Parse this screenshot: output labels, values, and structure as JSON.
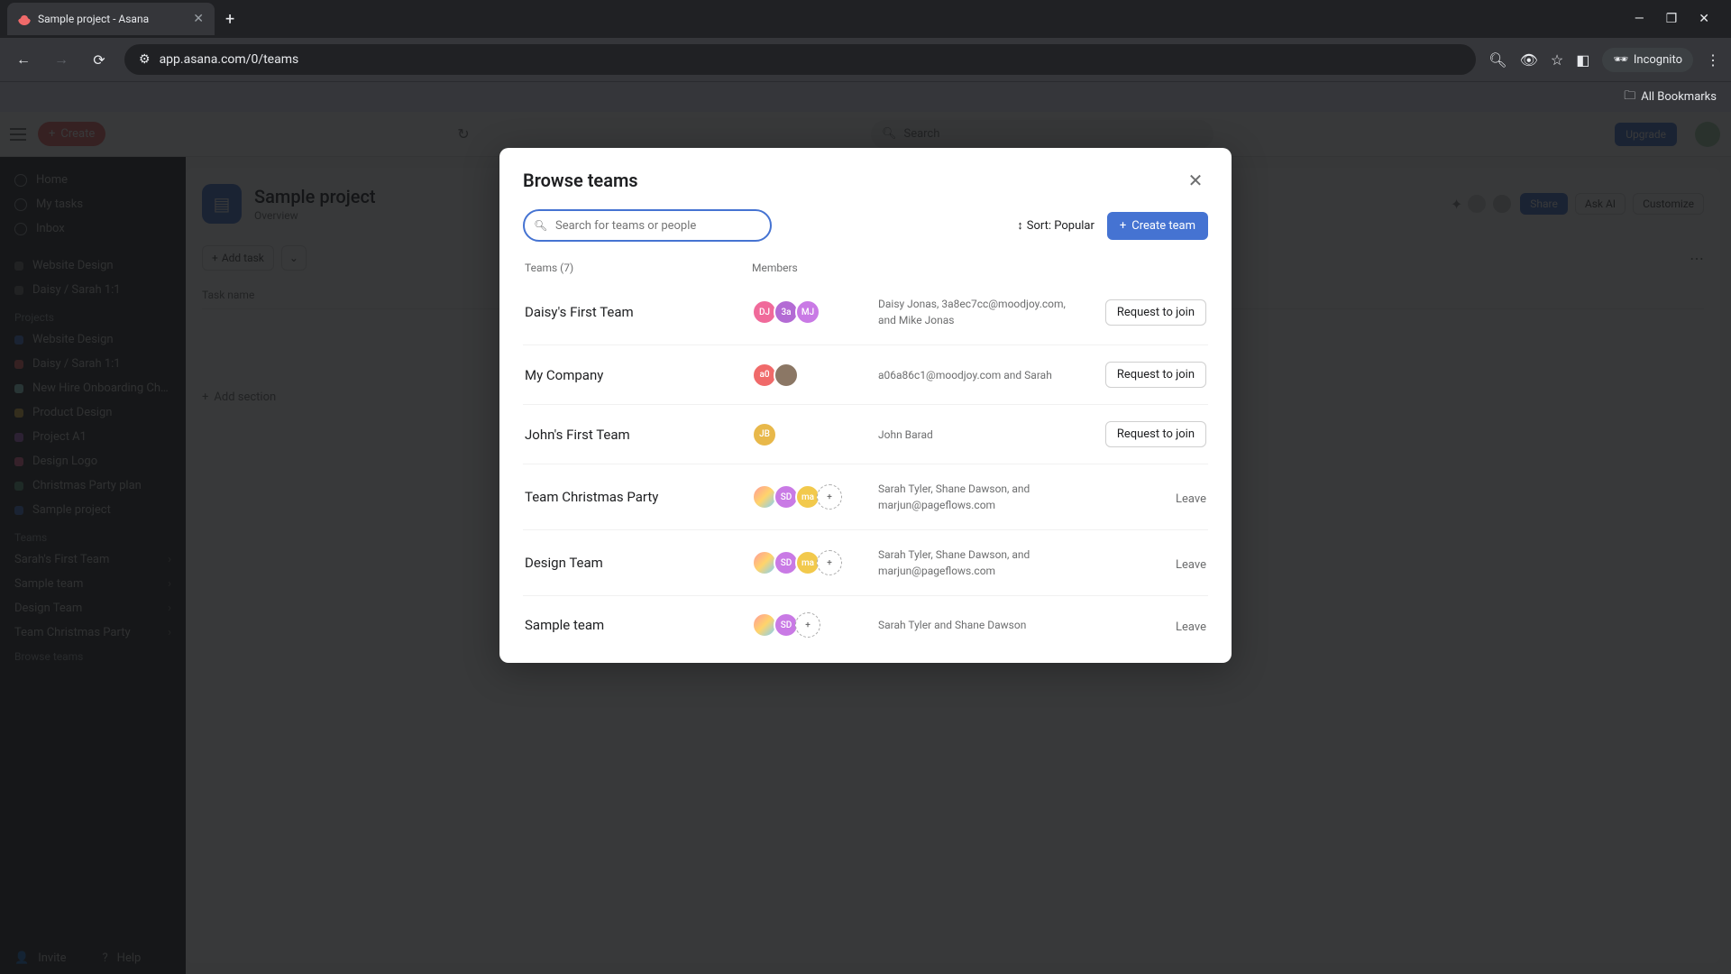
{
  "browser": {
    "tab_title": "Sample project - Asana",
    "url": "app.asana.com/0/teams",
    "incognito_label": "Incognito",
    "all_bookmarks": "All Bookmarks"
  },
  "app": {
    "create_label": "Create",
    "search_placeholder": "Search",
    "upgrade_label": "Upgrade",
    "sidebar": {
      "nav": [
        "Home",
        "My tasks",
        "Inbox"
      ],
      "recent": [
        "Website Design",
        "Daisy / Sarah 1:1"
      ],
      "projects_label": "Projects",
      "projects": [
        "Website Design",
        "Daisy / Sarah 1:1",
        "New Hire Onboarding Ch…",
        "Product Design",
        "Project A1",
        "Design Logo",
        "Christmas Party plan",
        "Sample project"
      ],
      "teams_label": "Teams",
      "teams": [
        "Sarah's First Team",
        "Sample team",
        "Design Team",
        "Team Christmas Party"
      ],
      "browse_teams": "Browse teams",
      "invite": "Invite",
      "help": "Help"
    },
    "project": {
      "title": "Sample project",
      "overview_tab": "Overview",
      "add_task": "Add task",
      "task_name_col": "Task name",
      "add_section": "Add section",
      "share": "Share",
      "ask_ai": "Ask AI",
      "customize": "Customize"
    }
  },
  "modal": {
    "title": "Browse teams",
    "search_placeholder": "Search for teams or people",
    "sort_label": "Sort: Popular",
    "create_team": "Create team",
    "teams_header": "Teams (7)",
    "members_header": "Members",
    "request_join": "Request to join",
    "leave": "Leave",
    "rows": [
      {
        "name": "Daisy's First Team",
        "avatars": [
          {
            "text": "DJ",
            "bg": "#f06a9a"
          },
          {
            "text": "3a",
            "bg": "#b36bd4"
          },
          {
            "text": "MJ",
            "bg": "#c97ae5"
          }
        ],
        "desc": "Daisy Jonas, 3a8ec7cc@moodjoy.com, and Mike Jonas",
        "action": "join"
      },
      {
        "name": "My Company",
        "avatars": [
          {
            "text": "a0",
            "bg": "#f06a6a"
          },
          {
            "text": "",
            "bg": "#8b7765",
            "img": true
          }
        ],
        "desc": "a06a86c1@moodjoy.com and Sarah",
        "action": "join"
      },
      {
        "name": "John's First Team",
        "avatars": [
          {
            "text": "JB",
            "bg": "#e8b84a"
          }
        ],
        "desc": "John Barad",
        "action": "join"
      },
      {
        "name": "Team Christmas Party",
        "avatars": [
          {
            "text": "",
            "bg": "",
            "icon": true
          },
          {
            "text": "SD",
            "bg": "#c97ae5"
          },
          {
            "text": "ma",
            "bg": "#f2c94c"
          },
          {
            "text": "+",
            "bg": "",
            "dashed": true
          }
        ],
        "desc": "Sarah Tyler, Shane Dawson, and marjun@pageflows.com",
        "action": "leave"
      },
      {
        "name": "Design Team",
        "avatars": [
          {
            "text": "",
            "bg": "",
            "icon": true
          },
          {
            "text": "SD",
            "bg": "#c97ae5"
          },
          {
            "text": "ma",
            "bg": "#f2c94c"
          },
          {
            "text": "+",
            "bg": "",
            "dashed": true
          }
        ],
        "desc": "Sarah Tyler, Shane Dawson, and marjun@pageflows.com",
        "action": "leave"
      },
      {
        "name": "Sample team",
        "avatars": [
          {
            "text": "",
            "bg": "",
            "icon": true
          },
          {
            "text": "SD",
            "bg": "#c97ae5"
          },
          {
            "text": "+",
            "bg": "",
            "dashed": true
          }
        ],
        "desc": "Sarah Tyler and Shane Dawson",
        "action": "leave"
      }
    ]
  }
}
